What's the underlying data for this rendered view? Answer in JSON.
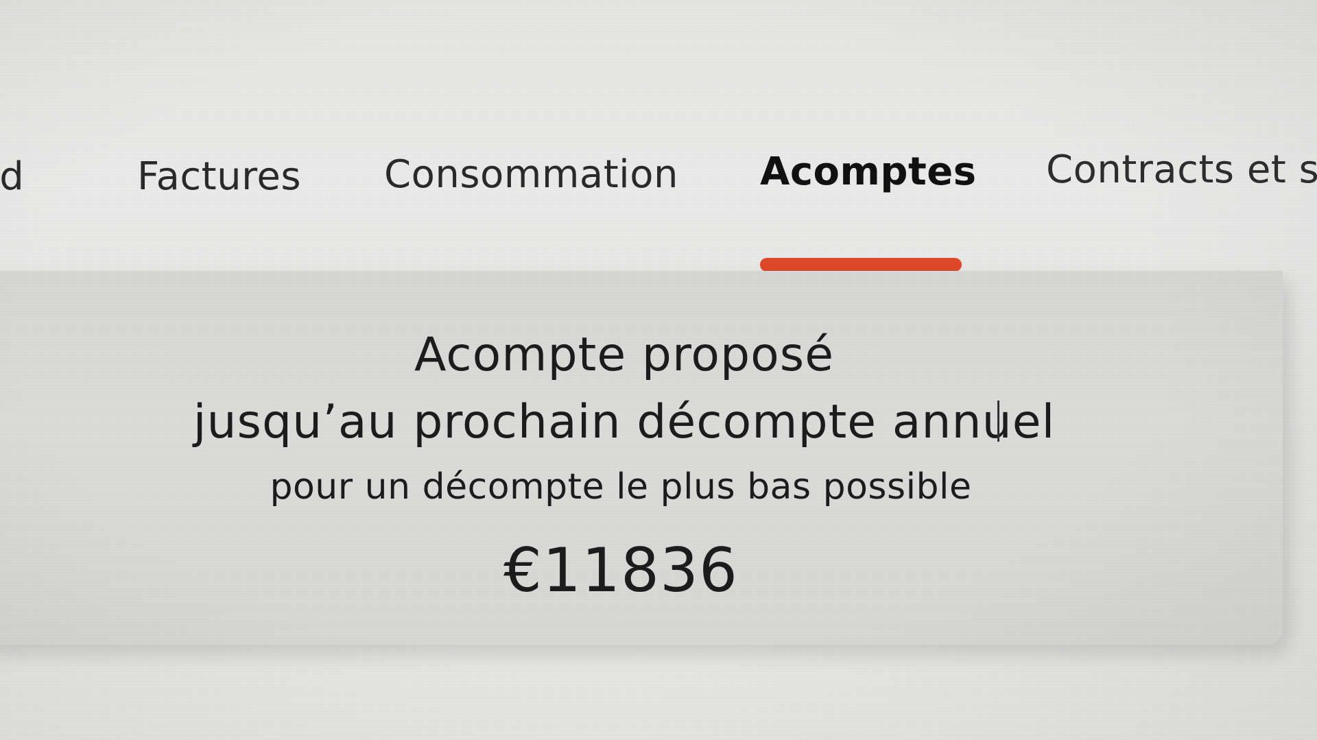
{
  "tabs": [
    {
      "label": "Tableau de bord",
      "visible_text": "ord",
      "active": false
    },
    {
      "label": "Factures",
      "active": false
    },
    {
      "label": "Consommation",
      "active": false
    },
    {
      "label": "Acomptes",
      "active": true
    },
    {
      "label": "Contracts et s",
      "active": false
    }
  ],
  "acompte": {
    "title": "Acompte proposé",
    "subtitle": "jusqu’au prochain décompte annuel",
    "note": "pour un décompte le plus bas possible",
    "amount": "€11836"
  },
  "colors": {
    "accent": "#e04a2a",
    "background": "#e8e8e6",
    "panel": "#d9d9d7",
    "text": "#1b1b1b"
  }
}
